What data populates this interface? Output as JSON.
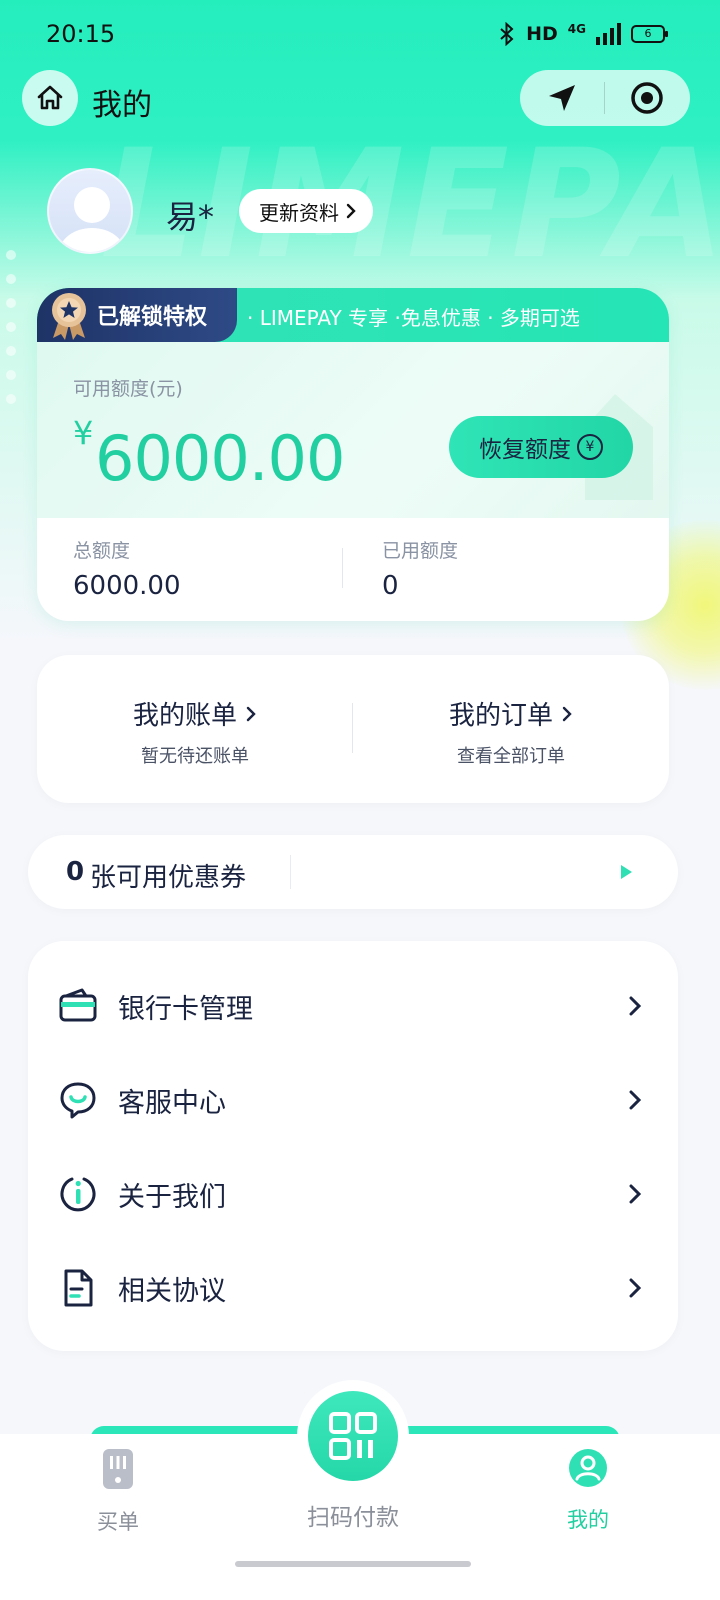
{
  "status_bar": {
    "time": "20:15",
    "network": "HD",
    "network_type": "4G",
    "battery": "6"
  },
  "header": {
    "title": "我的"
  },
  "background": {
    "watermark": "LIMEPAY"
  },
  "profile": {
    "name": "易*",
    "update_label": "更新资料"
  },
  "credit": {
    "privilege_label": "已解锁特权",
    "banner_text": "· LIMEPAY 专享 ·免息优惠 · 多期可选",
    "available_label": "可用额度(元)",
    "currency_symbol": "¥",
    "available_amount": "6000.00",
    "restore_label": "恢复额度",
    "restore_icon_text": "¥",
    "total_label": "总额度",
    "total_value": "6000.00",
    "used_label": "已用额度",
    "used_value": "0"
  },
  "bills": {
    "bill_title": "我的账单",
    "bill_subtitle": "暂无待还账单",
    "order_title": "我的订单",
    "order_subtitle": "查看全部订单"
  },
  "coupon": {
    "count": "0",
    "label": "张可用优惠券"
  },
  "menu": {
    "items": [
      {
        "label": "银行卡管理",
        "icon": "bank-card-icon"
      },
      {
        "label": "客服中心",
        "icon": "customer-service-icon"
      },
      {
        "label": "关于我们",
        "icon": "info-icon"
      },
      {
        "label": "相关协议",
        "icon": "document-icon"
      }
    ]
  },
  "bottom_nav": {
    "buy_label": "买单",
    "scan_label": "扫码付款",
    "mine_label": "我的"
  },
  "colors": {
    "brand": "#25EEBD",
    "accent_text": "#22CFA0",
    "navy": "#1A2340",
    "muted": "#8A93A3"
  }
}
